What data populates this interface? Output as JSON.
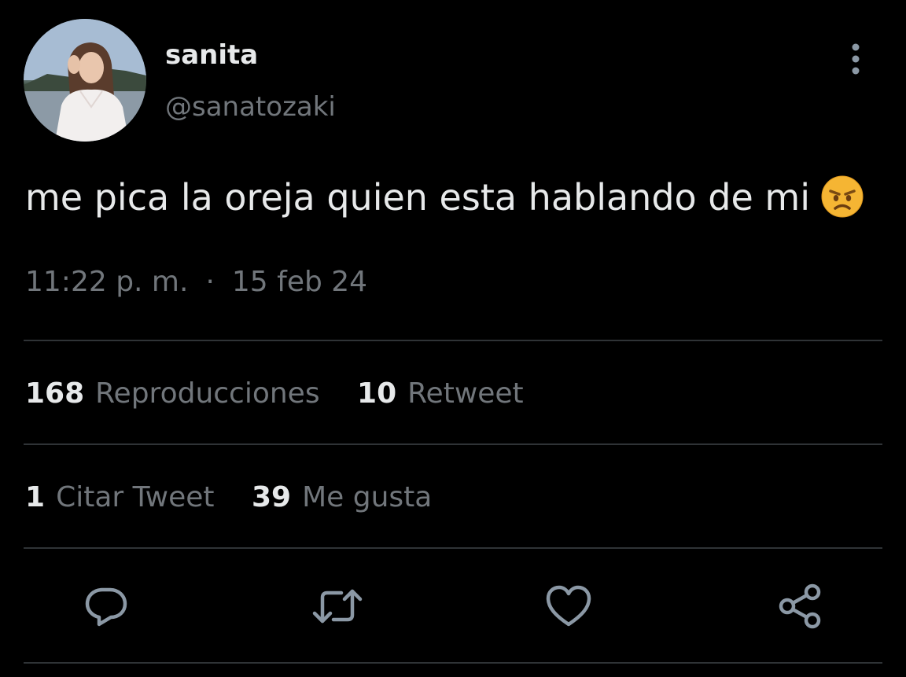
{
  "user": {
    "display_name": "sanita",
    "handle": "@sanatozaki"
  },
  "tweet": {
    "text": "me pica la oreja quien esta hablando de mi",
    "emoji": "angry-face-emoji",
    "time": "11:22 p. m.",
    "separator": "·",
    "date": "15 feb 24"
  },
  "stats": {
    "views": {
      "count": "168",
      "label": "Reproducciones"
    },
    "retweets": {
      "count": "10",
      "label": "Retweet"
    },
    "quotes": {
      "count": "1",
      "label": "Citar Tweet"
    },
    "likes": {
      "count": "39",
      "label": "Me gusta"
    }
  },
  "actions": [
    "reply-icon",
    "retweet-icon",
    "like-icon",
    "share-icon"
  ],
  "colors": {
    "background": "#000000",
    "primary_text": "#e7e9ea",
    "secondary_text": "#71767b",
    "divider": "#2f3336",
    "icon": "#8b98a5"
  }
}
